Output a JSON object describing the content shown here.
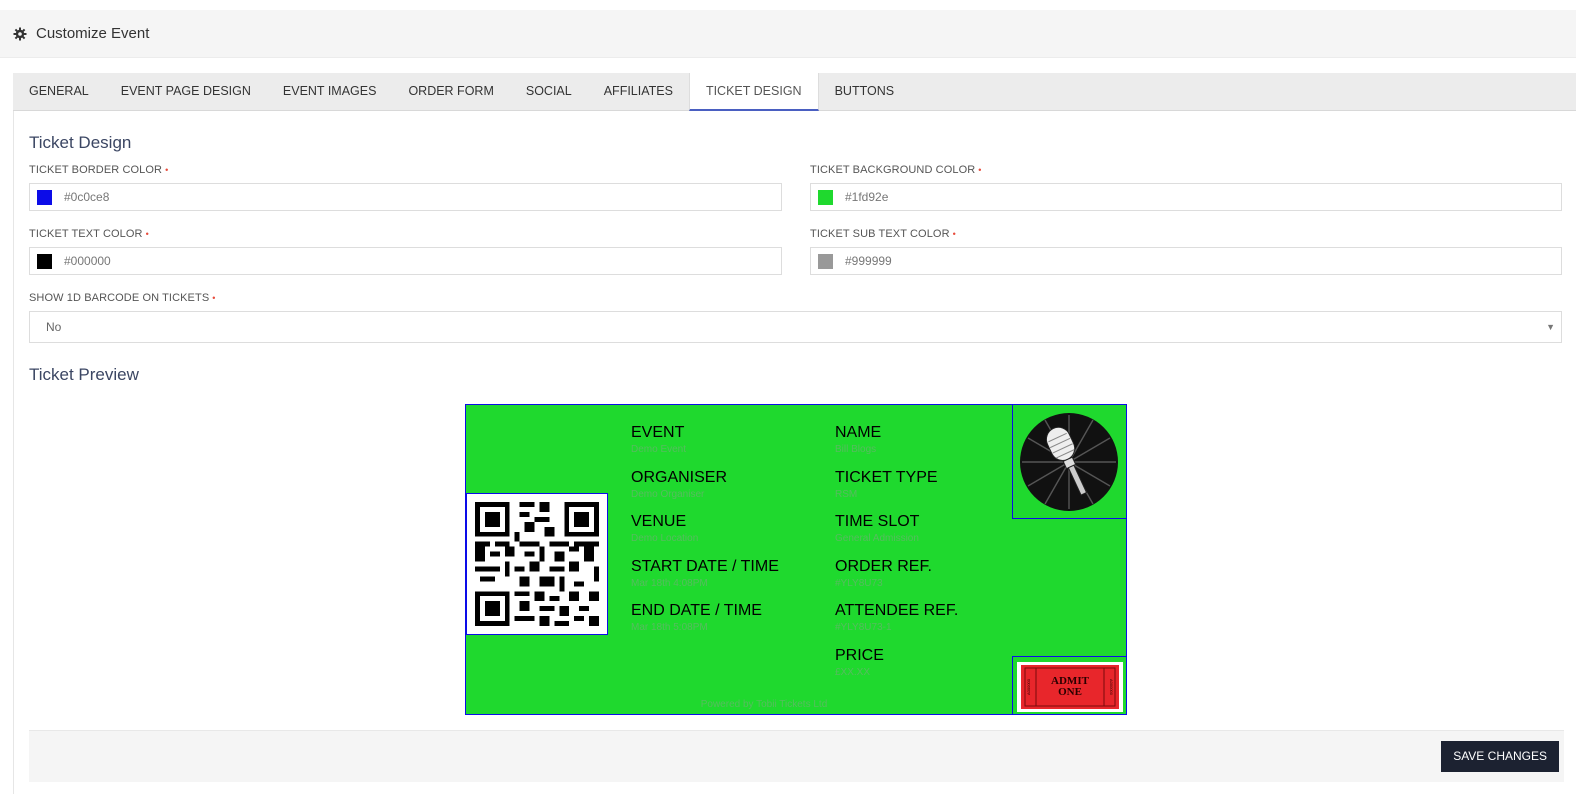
{
  "header": {
    "title": "Customize Event",
    "icon": "gear-icon"
  },
  "tabs": [
    {
      "label": "GENERAL"
    },
    {
      "label": "EVENT PAGE DESIGN"
    },
    {
      "label": "EVENT IMAGES"
    },
    {
      "label": "ORDER FORM"
    },
    {
      "label": "SOCIAL"
    },
    {
      "label": "AFFILIATES"
    },
    {
      "label": "TICKET DESIGN",
      "active": true
    },
    {
      "label": "BUTTONS"
    }
  ],
  "design": {
    "heading": "Ticket Design",
    "border_color": {
      "label": "TICKET BORDER COLOR",
      "value": "#0c0ce8"
    },
    "background_color": {
      "label": "TICKET BACKGROUND COLOR",
      "value": "#1fd92e"
    },
    "text_color": {
      "label": "TICKET TEXT COLOR",
      "value": "#000000"
    },
    "sub_text_color": {
      "label": "TICKET SUB TEXT COLOR",
      "value": "#999999"
    },
    "barcode": {
      "label": "SHOW 1D BARCODE ON TICKETS",
      "value": "No"
    },
    "required_marker": "•"
  },
  "preview": {
    "heading": "Ticket Preview",
    "left_fields": [
      {
        "label": "EVENT",
        "value": "Demo Event"
      },
      {
        "label": "ORGANISER",
        "value": "Demo Organiser"
      },
      {
        "label": "VENUE",
        "value": "Demo Location"
      },
      {
        "label": "START DATE / TIME",
        "value": "Mar 18th 4:08PM"
      },
      {
        "label": "END DATE / TIME",
        "value": "Mar 18th 5:08PM"
      }
    ],
    "right_fields": [
      {
        "label": "NAME",
        "value": "Bill Blogs"
      },
      {
        "label": "TICKET TYPE",
        "value": "RSM"
      },
      {
        "label": "TIME SLOT",
        "value": "General Admission"
      },
      {
        "label": "ORDER REF.",
        "value": "#YLY8U73"
      },
      {
        "label": "ATTENDEE REF.",
        "value": "#YLY8U73-1"
      },
      {
        "label": "PRICE",
        "value": "£XX.XX"
      }
    ],
    "admit": {
      "line1": "ADMIT",
      "line2": "ONE",
      "serial": "A000000"
    },
    "powered_by": "Powered by Tobii Tickets Ltd"
  },
  "footer": {
    "save_label": "SAVE CHANGES"
  }
}
